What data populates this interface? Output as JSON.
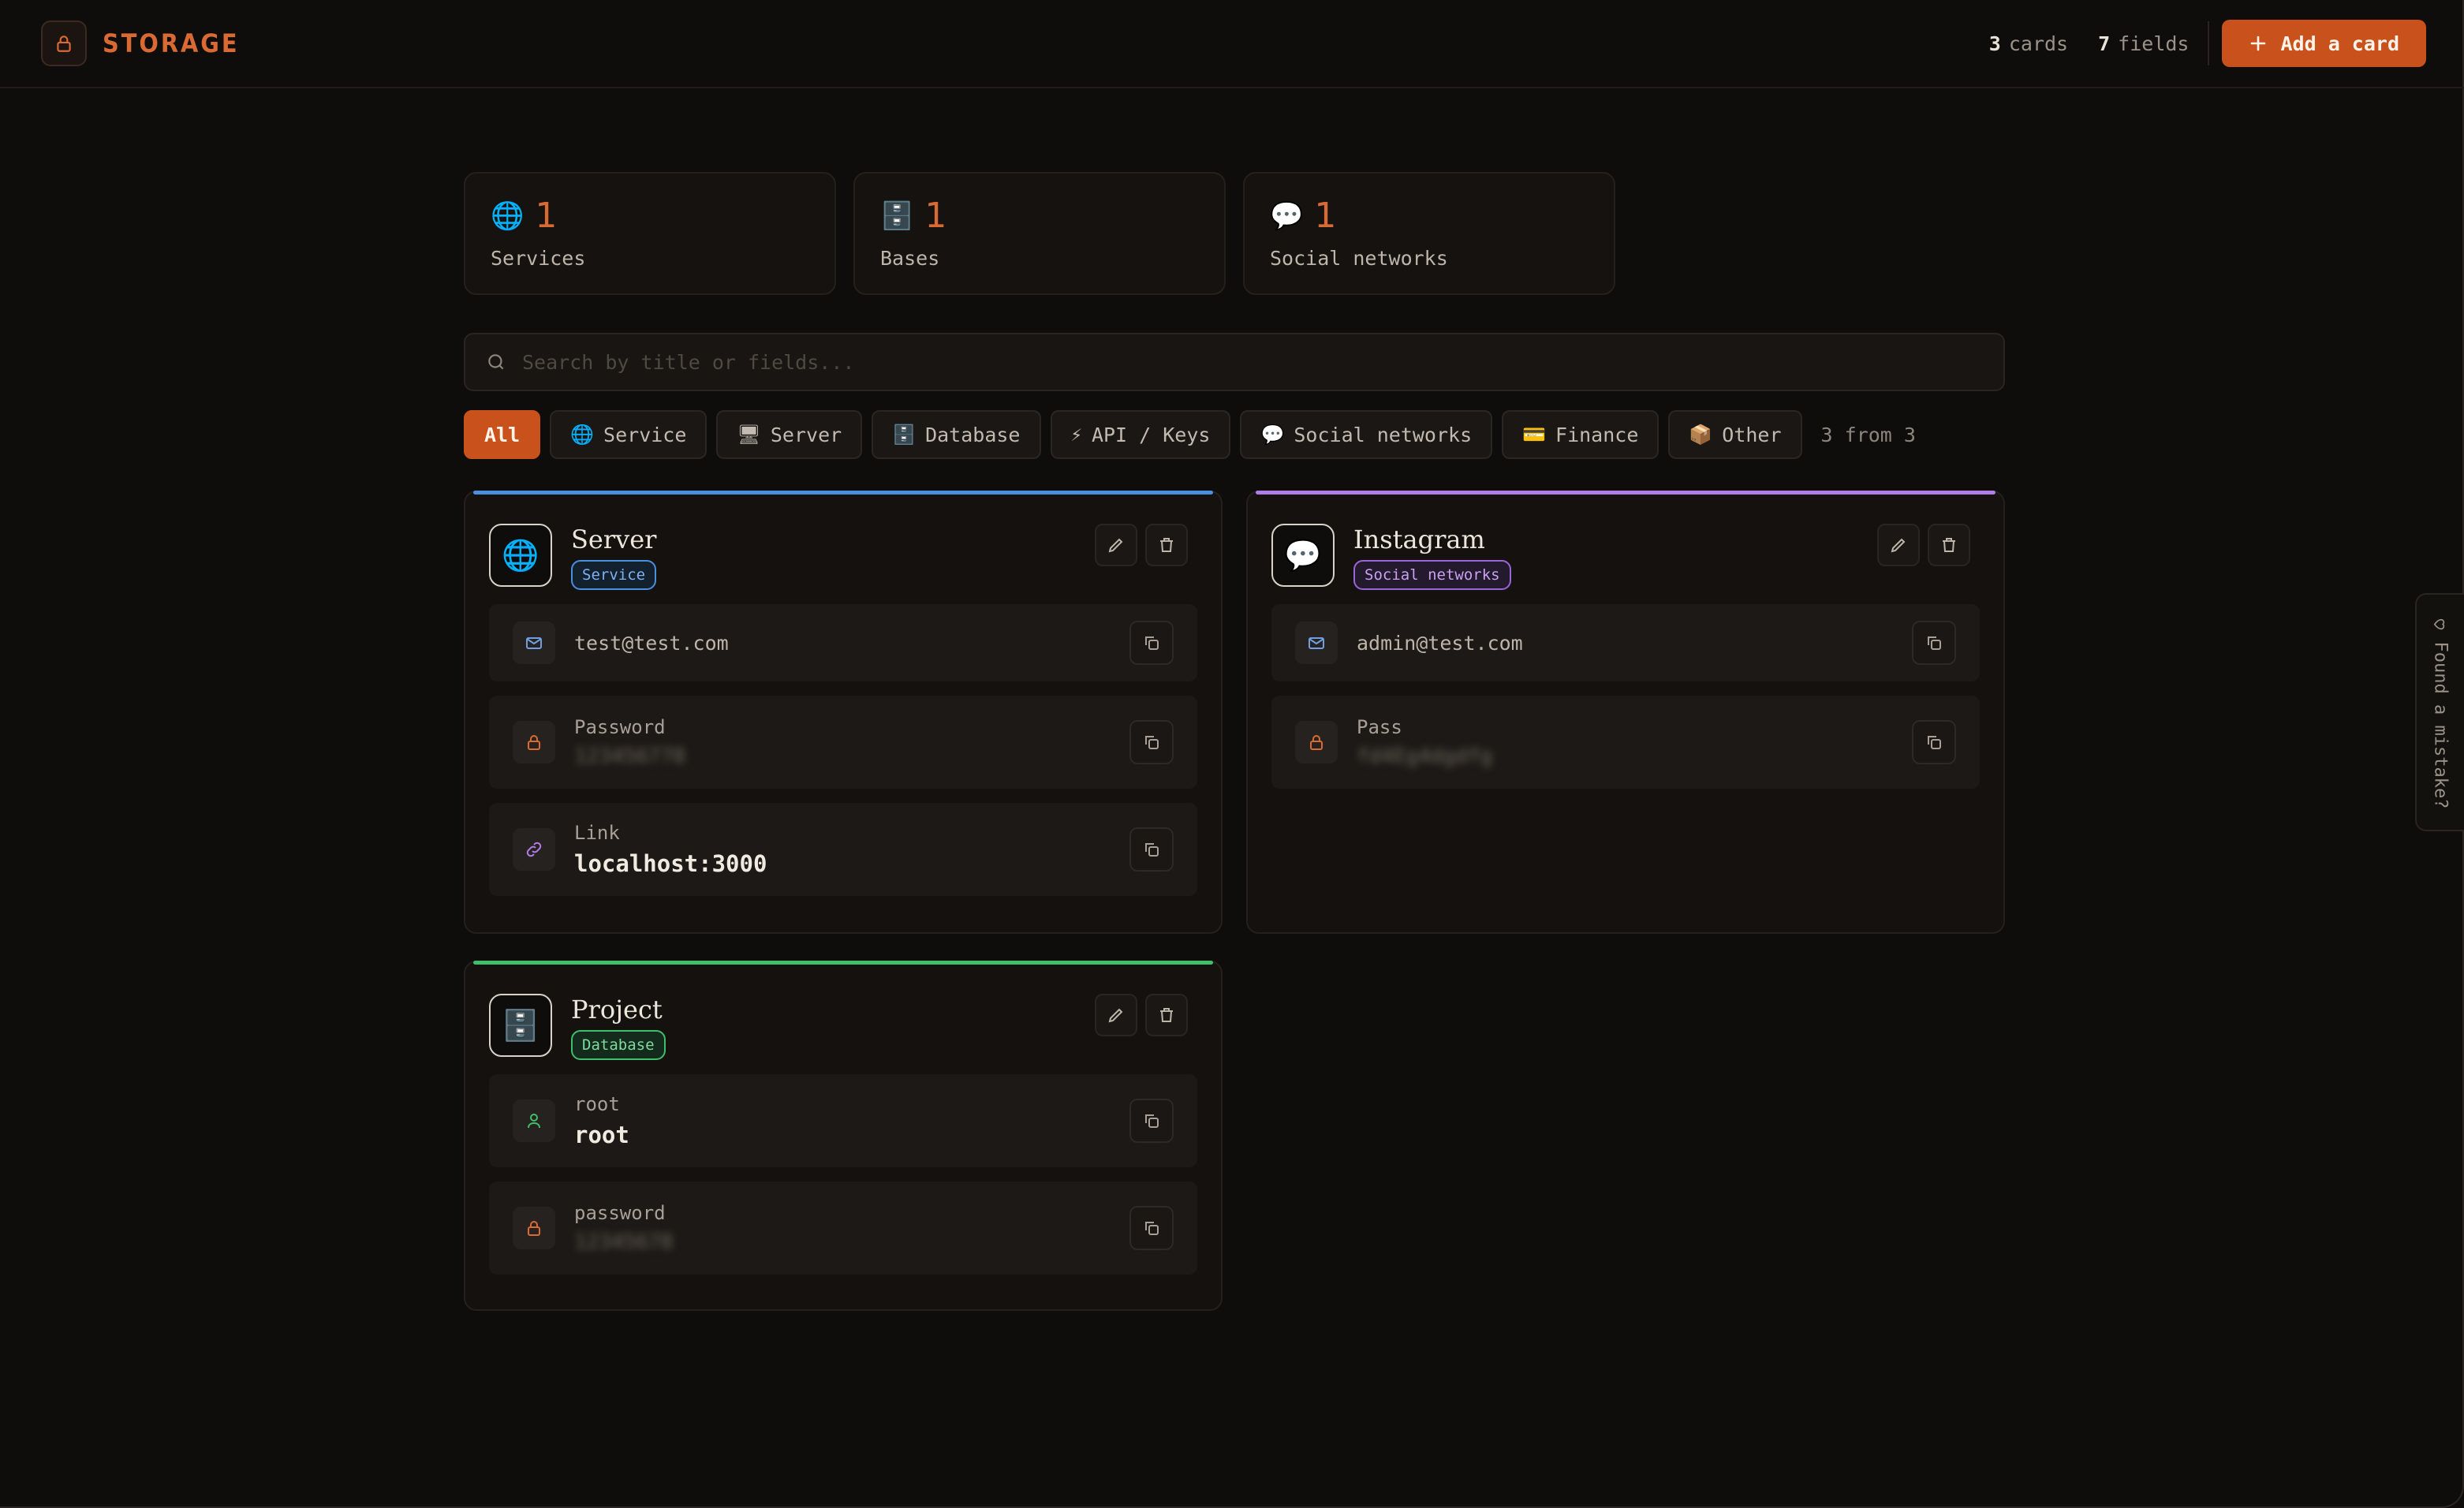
{
  "app": {
    "logo_icon": "lock-icon",
    "title": "STORAGE"
  },
  "header": {
    "cards_count": "3",
    "cards_label": "cards",
    "fields_count": "7",
    "fields_label": "fields",
    "add_button_label": "Add a card",
    "add_button_icon": "plus-icon"
  },
  "stats": [
    {
      "icon": "globe-icon",
      "value": "1",
      "label": "Services"
    },
    {
      "icon": "file-cabinet-icon",
      "value": "1",
      "label": "Bases"
    },
    {
      "icon": "speech-bubble-icon",
      "value": "1",
      "label": "Social networks"
    }
  ],
  "search": {
    "placeholder": "Search by title or fields...",
    "value": ""
  },
  "filters": {
    "chips": [
      {
        "label": "All",
        "icon": "",
        "active": true
      },
      {
        "label": "Service",
        "icon": "globe-icon",
        "active": false
      },
      {
        "label": "Server",
        "icon": "desktop-computer-icon",
        "active": false
      },
      {
        "label": "Database",
        "icon": "file-cabinet-icon",
        "active": false
      },
      {
        "label": "API / Keys",
        "icon": "lightning-icon",
        "active": false
      },
      {
        "label": "Social networks",
        "icon": "speech-bubble-icon",
        "active": false
      },
      {
        "label": "Finance",
        "icon": "credit-card-icon",
        "active": false
      },
      {
        "label": "Other",
        "icon": "package-icon",
        "active": false
      }
    ],
    "result_note": "3 from 3"
  },
  "cards": [
    {
      "title": "Server",
      "category": "Service",
      "category_icon": "globe-icon",
      "accent": "#4a8fe0",
      "fields": [
        {
          "icon": "mail-icon",
          "label": "",
          "value": "test@test.com",
          "masked": false
        },
        {
          "icon": "lock-icon",
          "label": "Password",
          "value": "123456778",
          "masked": true
        },
        {
          "icon": "link-icon",
          "label": "Link",
          "value": "localhost:3000",
          "masked": false
        }
      ]
    },
    {
      "title": "Instagram",
      "category": "Social networks",
      "category_icon": "speech-bubble-icon",
      "accent": "#b07ce8",
      "fields": [
        {
          "icon": "mail-icon",
          "label": "",
          "value": "admin@test.com",
          "masked": false
        },
        {
          "icon": "lock-icon",
          "label": "Pass",
          "value": "fd4Eg4dgdfg",
          "masked": true
        }
      ]
    },
    {
      "title": "Project",
      "category": "Database",
      "category_icon": "file-cabinet-icon",
      "accent": "#3fbf6a",
      "fields": [
        {
          "icon": "user-icon",
          "label": "root",
          "value": "root",
          "masked": false
        },
        {
          "icon": "lock-icon",
          "label": "password",
          "value": "12345678",
          "masked": true
        }
      ]
    }
  ],
  "feedback_tab": {
    "label": "Found a mistake?",
    "icon": "heart-icon"
  },
  "colors": {
    "accent": "#c9521c",
    "background": "#0f0d0b",
    "service": "#4a8fe0",
    "social": "#b07ce8",
    "database": "#3fbf6a"
  }
}
